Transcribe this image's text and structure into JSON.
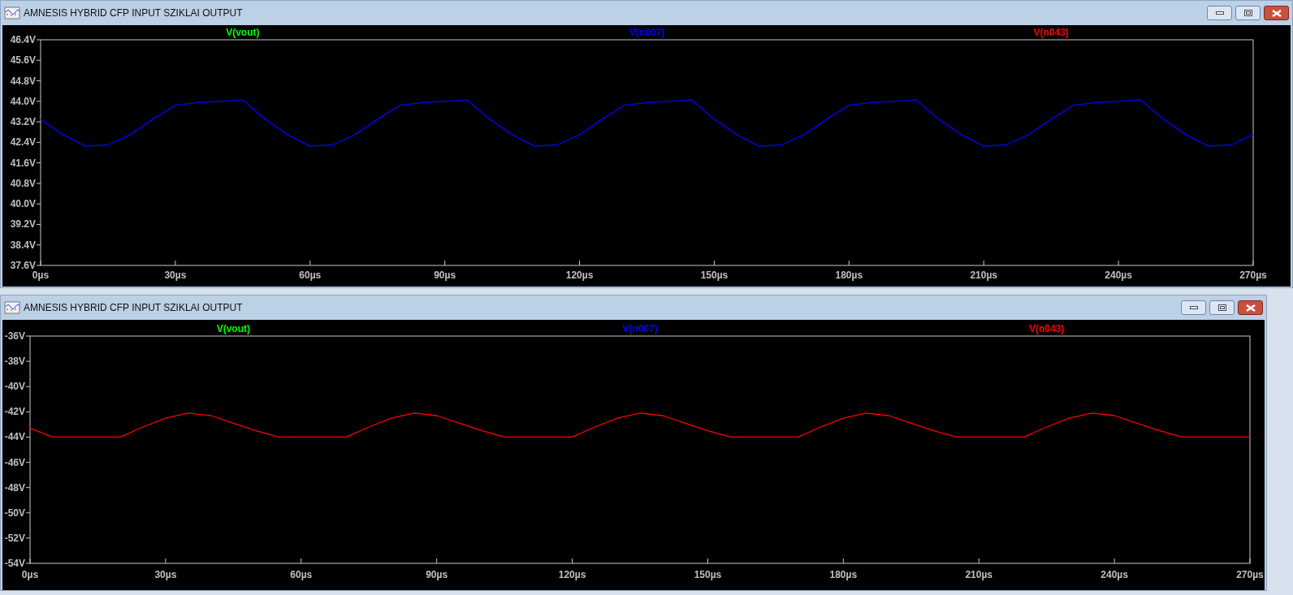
{
  "windows": [
    {
      "title": "AMNESIS HYBRID CFP INPUT SZIKLAI OUTPUT",
      "chart_data": {
        "type": "line",
        "x": [
          0,
          5,
          10,
          15,
          20,
          25,
          30,
          35,
          40,
          45,
          50,
          55,
          60,
          65,
          70,
          75,
          80,
          85,
          90,
          95,
          100,
          105,
          110,
          115,
          120,
          125,
          130,
          135,
          140,
          145,
          150,
          155,
          160,
          165,
          170,
          175,
          180,
          185,
          190,
          195,
          200,
          205,
          210,
          215,
          220,
          225,
          230,
          235,
          240,
          245,
          250,
          255,
          260,
          265,
          270
        ],
        "xlim": [
          0,
          270
        ],
        "ylim": [
          37.6,
          46.4
        ],
        "xticks": [
          {
            "value": 0,
            "label": "0µs"
          },
          {
            "value": 30,
            "label": "30µs"
          },
          {
            "value": 60,
            "label": "60µs"
          },
          {
            "value": 90,
            "label": "90µs"
          },
          {
            "value": 120,
            "label": "120µs"
          },
          {
            "value": 150,
            "label": "150µs"
          },
          {
            "value": 180,
            "label": "180µs"
          },
          {
            "value": 210,
            "label": "210µs"
          },
          {
            "value": 240,
            "label": "240µs"
          },
          {
            "value": 270,
            "label": "270µs"
          }
        ],
        "yticks": [
          {
            "value": 37.6,
            "label": "37.6V"
          },
          {
            "value": 38.4,
            "label": "38.4V"
          },
          {
            "value": 39.2,
            "label": "39.2V"
          },
          {
            "value": 40.0,
            "label": "40.0V"
          },
          {
            "value": 40.8,
            "label": "40.8V"
          },
          {
            "value": 41.6,
            "label": "41.6V"
          },
          {
            "value": 42.4,
            "label": "42.4V"
          },
          {
            "value": 43.2,
            "label": "43.2V"
          },
          {
            "value": 44.0,
            "label": "44.0V"
          },
          {
            "value": 44.8,
            "label": "44.8V"
          },
          {
            "value": 45.6,
            "label": "45.6V"
          },
          {
            "value": 46.4,
            "label": "46.4V"
          }
        ],
        "series": [
          {
            "name": "V(vout)",
            "color": "#00ff00",
            "values": [
              null,
              null,
              null,
              null,
              null,
              null,
              null,
              null,
              null,
              null,
              null,
              null,
              null,
              null,
              null,
              null,
              null,
              null,
              null,
              null,
              null,
              null,
              null,
              null,
              null,
              null,
              null,
              null,
              null,
              null,
              null,
              null,
              null,
              null,
              null,
              null,
              null,
              null,
              null,
              null,
              null,
              null,
              null,
              null,
              null,
              null,
              null,
              null,
              null,
              null,
              null,
              null,
              null,
              null,
              null
            ]
          },
          {
            "name": "V(n007)",
            "color": "#0000ff",
            "values": [
              43.3,
              42.7,
              42.25,
              42.3,
              42.7,
              43.3,
              43.85,
              43.95,
              44.0,
              44.05,
              43.3,
              42.7,
              42.25,
              42.3,
              42.7,
              43.3,
              43.85,
              43.95,
              44.0,
              44.05,
              43.3,
              42.7,
              42.25,
              42.3,
              42.7,
              43.3,
              43.85,
              43.95,
              44.0,
              44.05,
              43.3,
              42.7,
              42.25,
              42.3,
              42.7,
              43.3,
              43.85,
              43.95,
              44.0,
              44.05,
              43.3,
              42.7,
              42.25,
              42.3,
              42.7,
              43.3,
              43.85,
              43.95,
              44.0,
              44.05,
              43.3,
              42.7,
              42.25,
              42.3,
              42.7
            ]
          },
          {
            "name": "V(n043)",
            "color": "#ff0000",
            "values": [
              null,
              null,
              null,
              null,
              null,
              null,
              null,
              null,
              null,
              null,
              null,
              null,
              null,
              null,
              null,
              null,
              null,
              null,
              null,
              null,
              null,
              null,
              null,
              null,
              null,
              null,
              null,
              null,
              null,
              null,
              null,
              null,
              null,
              null,
              null,
              null,
              null,
              null,
              null,
              null,
              null,
              null,
              null,
              null,
              null,
              null,
              null,
              null,
              null,
              null,
              null,
              null,
              null,
              null,
              null
            ]
          }
        ]
      }
    },
    {
      "title": "AMNESIS HYBRID CFP INPUT SZIKLAI OUTPUT",
      "chart_data": {
        "type": "line",
        "x": [
          0,
          5,
          10,
          15,
          20,
          25,
          30,
          35,
          40,
          45,
          50,
          55,
          60,
          65,
          70,
          75,
          80,
          85,
          90,
          95,
          100,
          105,
          110,
          115,
          120,
          125,
          130,
          135,
          140,
          145,
          150,
          155,
          160,
          165,
          170,
          175,
          180,
          185,
          190,
          195,
          200,
          205,
          210,
          215,
          220,
          225,
          230,
          235,
          240,
          245,
          250,
          255,
          260,
          265,
          270
        ],
        "xlim": [
          0,
          270
        ],
        "ylim": [
          -54,
          -36
        ],
        "xticks": [
          {
            "value": 0,
            "label": "0µs"
          },
          {
            "value": 30,
            "label": "30µs"
          },
          {
            "value": 60,
            "label": "60µs"
          },
          {
            "value": 90,
            "label": "90µs"
          },
          {
            "value": 120,
            "label": "120µs"
          },
          {
            "value": 150,
            "label": "150µs"
          },
          {
            "value": 180,
            "label": "180µs"
          },
          {
            "value": 210,
            "label": "210µs"
          },
          {
            "value": 240,
            "label": "240µs"
          },
          {
            "value": 270,
            "label": "270µs"
          }
        ],
        "yticks": [
          {
            "value": -54,
            "label": "-54V"
          },
          {
            "value": -52,
            "label": "-52V"
          },
          {
            "value": -50,
            "label": "-50V"
          },
          {
            "value": -48,
            "label": "-48V"
          },
          {
            "value": -46,
            "label": "-46V"
          },
          {
            "value": -44,
            "label": "-44V"
          },
          {
            "value": -42,
            "label": "-42V"
          },
          {
            "value": -40,
            "label": "-40V"
          },
          {
            "value": -38,
            "label": "-38V"
          },
          {
            "value": -36,
            "label": "-36V"
          }
        ],
        "series": [
          {
            "name": "V(vout)",
            "color": "#00ff00",
            "values": [
              null,
              null,
              null,
              null,
              null,
              null,
              null,
              null,
              null,
              null,
              null,
              null,
              null,
              null,
              null,
              null,
              null,
              null,
              null,
              null,
              null,
              null,
              null,
              null,
              null,
              null,
              null,
              null,
              null,
              null,
              null,
              null,
              null,
              null,
              null,
              null,
              null,
              null,
              null,
              null,
              null,
              null,
              null,
              null,
              null,
              null,
              null,
              null,
              null,
              null,
              null,
              null,
              null,
              null,
              null
            ]
          },
          {
            "name": "V(n007)",
            "color": "#0000ff",
            "values": [
              null,
              null,
              null,
              null,
              null,
              null,
              null,
              null,
              null,
              null,
              null,
              null,
              null,
              null,
              null,
              null,
              null,
              null,
              null,
              null,
              null,
              null,
              null,
              null,
              null,
              null,
              null,
              null,
              null,
              null,
              null,
              null,
              null,
              null,
              null,
              null,
              null,
              null,
              null,
              null,
              null,
              null,
              null,
              null,
              null,
              null,
              null,
              null,
              null,
              null,
              null,
              null,
              null,
              null,
              null
            ]
          },
          {
            "name": "V(n043)",
            "color": "#ff0000",
            "values": [
              -43.3,
              -44.0,
              -44.0,
              -44.0,
              -44.0,
              -43.2,
              -42.5,
              -42.1,
              -42.3,
              -42.9,
              -43.5,
              -44.0,
              -44.0,
              -44.0,
              -44.0,
              -43.2,
              -42.5,
              -42.1,
              -42.3,
              -42.9,
              -43.5,
              -44.0,
              -44.0,
              -44.0,
              -44.0,
              -43.2,
              -42.5,
              -42.1,
              -42.3,
              -42.9,
              -43.5,
              -44.0,
              -44.0,
              -44.0,
              -44.0,
              -43.2,
              -42.5,
              -42.1,
              -42.3,
              -42.9,
              -43.5,
              -44.0,
              -44.0,
              -44.0,
              -44.0,
              -43.2,
              -42.5,
              -42.1,
              -42.3,
              -42.9,
              -43.5,
              -44.0,
              -44.0,
              -44.0,
              -44.0
            ]
          }
        ]
      }
    }
  ]
}
